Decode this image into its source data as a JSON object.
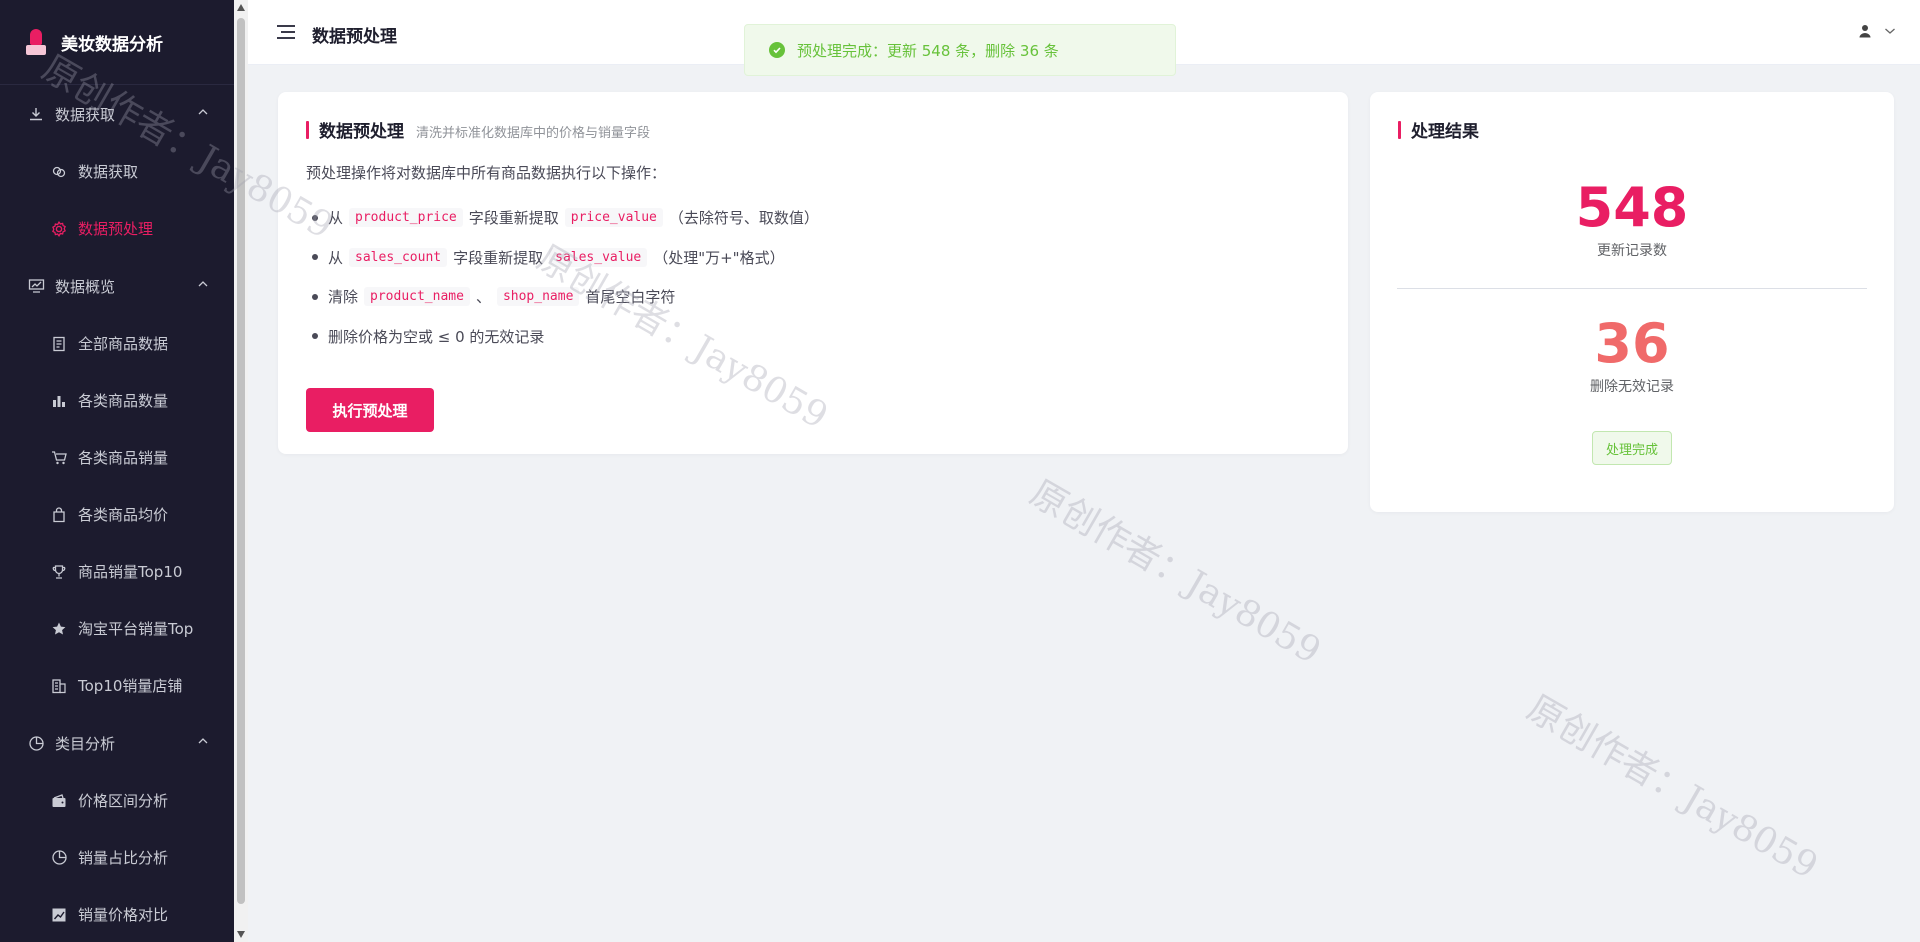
{
  "app": {
    "title": "美妆数据分析"
  },
  "sidebar": {
    "groups": [
      {
        "label": "数据获取",
        "icon": "download-icon",
        "items": [
          {
            "label": "数据获取",
            "icon": "link-icon"
          },
          {
            "label": "数据预处理",
            "icon": "gear-icon",
            "active": true
          }
        ]
      },
      {
        "label": "数据概览",
        "icon": "monitor-chart-icon",
        "items": [
          {
            "label": "全部商品数据",
            "icon": "document-icon"
          },
          {
            "label": "各类商品数量",
            "icon": "bar-chart-icon"
          },
          {
            "label": "各类商品销量",
            "icon": "cart-icon"
          },
          {
            "label": "各类商品均价",
            "icon": "price-tag-icon"
          },
          {
            "label": "商品销量Top10",
            "icon": "trophy-icon"
          },
          {
            "label": "淘宝平台销量Top",
            "icon": "star-icon"
          },
          {
            "label": "Top10销量店铺",
            "icon": "building-icon"
          }
        ]
      },
      {
        "label": "类目分析",
        "icon": "pie-icon",
        "items": [
          {
            "label": "价格区间分析",
            "icon": "wallet-icon"
          },
          {
            "label": "销量占比分析",
            "icon": "pie-icon"
          },
          {
            "label": "销量价格对比",
            "icon": "trend-icon"
          }
        ]
      }
    ]
  },
  "header": {
    "page_title": "数据预处理"
  },
  "toast": {
    "message": "预处理完成：更新 548 条，删除 36 条"
  },
  "main": {
    "title": "数据预处理",
    "subtitle": "清洗并标准化数据库中的价格与销量字段",
    "intro": "预处理操作将对数据库中所有商品数据执行以下操作：",
    "ops": {
      "op1": {
        "a": "从",
        "code1": "product_price",
        "b": "字段重新提取",
        "code2": "price_value",
        "c": "（去除符号、取数值）"
      },
      "op2": {
        "a": "从",
        "code1": "sales_count",
        "b": "字段重新提取",
        "code2": "sales_value",
        "c": "（处理\"万+\"格式）"
      },
      "op3": {
        "a": "清除",
        "code1": "product_name",
        "b": "、",
        "code2": "shop_name",
        "c": "首尾空白字符"
      },
      "op4": {
        "text": "删除价格为空或 ≤ 0 的无效记录"
      }
    },
    "run_button": "执行预处理"
  },
  "result": {
    "title": "处理结果",
    "updated_count": "548",
    "updated_label": "更新记录数",
    "deleted_count": "36",
    "deleted_label": "删除无效记录",
    "status": "处理完成"
  },
  "watermark": {
    "text": "原创作者：Jay8059"
  },
  "colors": {
    "accent": "#e91e63",
    "deleted": "#f06a6a",
    "success": "#67c23a",
    "sidebar_bg": "#1c1b2e"
  }
}
